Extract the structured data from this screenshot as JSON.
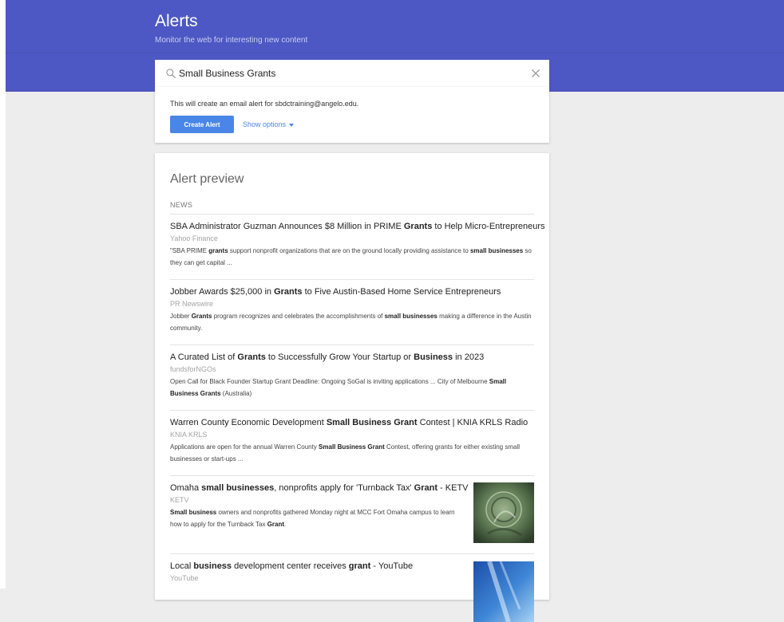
{
  "header": {
    "title": "Alerts",
    "subtitle": "Monitor the web for interesting new content",
    "background_color": "#4d58c4"
  },
  "search": {
    "value": "Small Business Grants",
    "search_icon": "search-icon",
    "clear_icon": "close-icon"
  },
  "create": {
    "note": "This will create an email alert for sbdctraining@angelo.edu.",
    "button_label": "Create Alert",
    "show_options_label": "Show options",
    "button_color": "#4a86e8"
  },
  "preview": {
    "heading": "Alert preview",
    "section_label": "NEWS",
    "items": [
      {
        "title_segments": [
          {
            "text": "SBA Administrator Guzman Announces $8 Million in PRIME ",
            "bold": false
          },
          {
            "text": "Grants",
            "bold": true
          },
          {
            "text": " to Help Micro-Entrepreneurs",
            "bold": false
          }
        ],
        "source": "Yahoo Finance",
        "snippet_segments": [
          {
            "text": "\"SBA PRIME ",
            "bold": false
          },
          {
            "text": "grants",
            "bold": true
          },
          {
            "text": " support nonprofit organizations that are on the ground locally providing assistance to ",
            "bold": false
          },
          {
            "text": "small businesses",
            "bold": true
          },
          {
            "text": " so they can get capital ...",
            "bold": false
          }
        ]
      },
      {
        "title_segments": [
          {
            "text": "Jobber Awards $25,000 in ",
            "bold": false
          },
          {
            "text": "Grants",
            "bold": true
          },
          {
            "text": " to Five Austin-Based Home Service Entrepreneurs",
            "bold": false
          }
        ],
        "source": "PR Newswire",
        "snippet_segments": [
          {
            "text": "Jobber ",
            "bold": false
          },
          {
            "text": "Grants",
            "bold": true
          },
          {
            "text": " program recognizes and celebrates the accomplishments of ",
            "bold": false
          },
          {
            "text": "small businesses",
            "bold": true
          },
          {
            "text": " making a difference in the Austin community.",
            "bold": false
          }
        ]
      },
      {
        "title_segments": [
          {
            "text": "A Curated List of ",
            "bold": false
          },
          {
            "text": "Grants",
            "bold": true
          },
          {
            "text": " to Successfully Grow Your Startup or ",
            "bold": false
          },
          {
            "text": "Business",
            "bold": true
          },
          {
            "text": " in 2023",
            "bold": false
          }
        ],
        "source": "fundsforNGOs",
        "snippet_segments": [
          {
            "text": "Open Call for Black Founder Startup Grant Deadline: Ongoing SoGal is inviting applications ... City of Melbourne ",
            "bold": false
          },
          {
            "text": "Small Business Grants",
            "bold": true
          },
          {
            "text": " (Australia)",
            "bold": false
          }
        ]
      },
      {
        "title_segments": [
          {
            "text": "Warren County Economic Development ",
            "bold": false
          },
          {
            "text": "Small Business Grant",
            "bold": true
          },
          {
            "text": " Contest | KNIA KRLS Radio",
            "bold": false
          }
        ],
        "source": "KNIA KRLS",
        "snippet_segments": [
          {
            "text": "Applications are open for the annual Warren County ",
            "bold": false
          },
          {
            "text": "Small Business Grant",
            "bold": true
          },
          {
            "text": " Contest, offering grants for either existing small businesses or start-ups ...",
            "bold": false
          }
        ]
      },
      {
        "title_segments": [
          {
            "text": "Omaha ",
            "bold": false
          },
          {
            "text": "small businesses",
            "bold": true
          },
          {
            "text": ", nonprofits apply for 'Turnback Tax' ",
            "bold": false
          },
          {
            "text": "Grant",
            "bold": true
          },
          {
            "text": " - KETV",
            "bold": false
          }
        ],
        "source": "KETV",
        "snippet_segments": [
          {
            "text": "Small business",
            "bold": true
          },
          {
            "text": " owners and nonprofits gathered Monday night at MCC Fort Omaha campus to learn how to apply for the Turnback Tax ",
            "bold": false
          },
          {
            "text": "Grant",
            "bold": true
          },
          {
            "text": ".",
            "bold": false
          }
        ],
        "thumbnail": "currency-engraving-thumbnail"
      },
      {
        "title_segments": [
          {
            "text": "Local ",
            "bold": false
          },
          {
            "text": "business",
            "bold": true
          },
          {
            "text": " development center receives ",
            "bold": false
          },
          {
            "text": "grant",
            "bold": true
          },
          {
            "text": " - YouTube",
            "bold": false
          }
        ],
        "source": "YouTube",
        "snippet_segments": [],
        "thumbnail": "video-thumbnail"
      }
    ]
  }
}
